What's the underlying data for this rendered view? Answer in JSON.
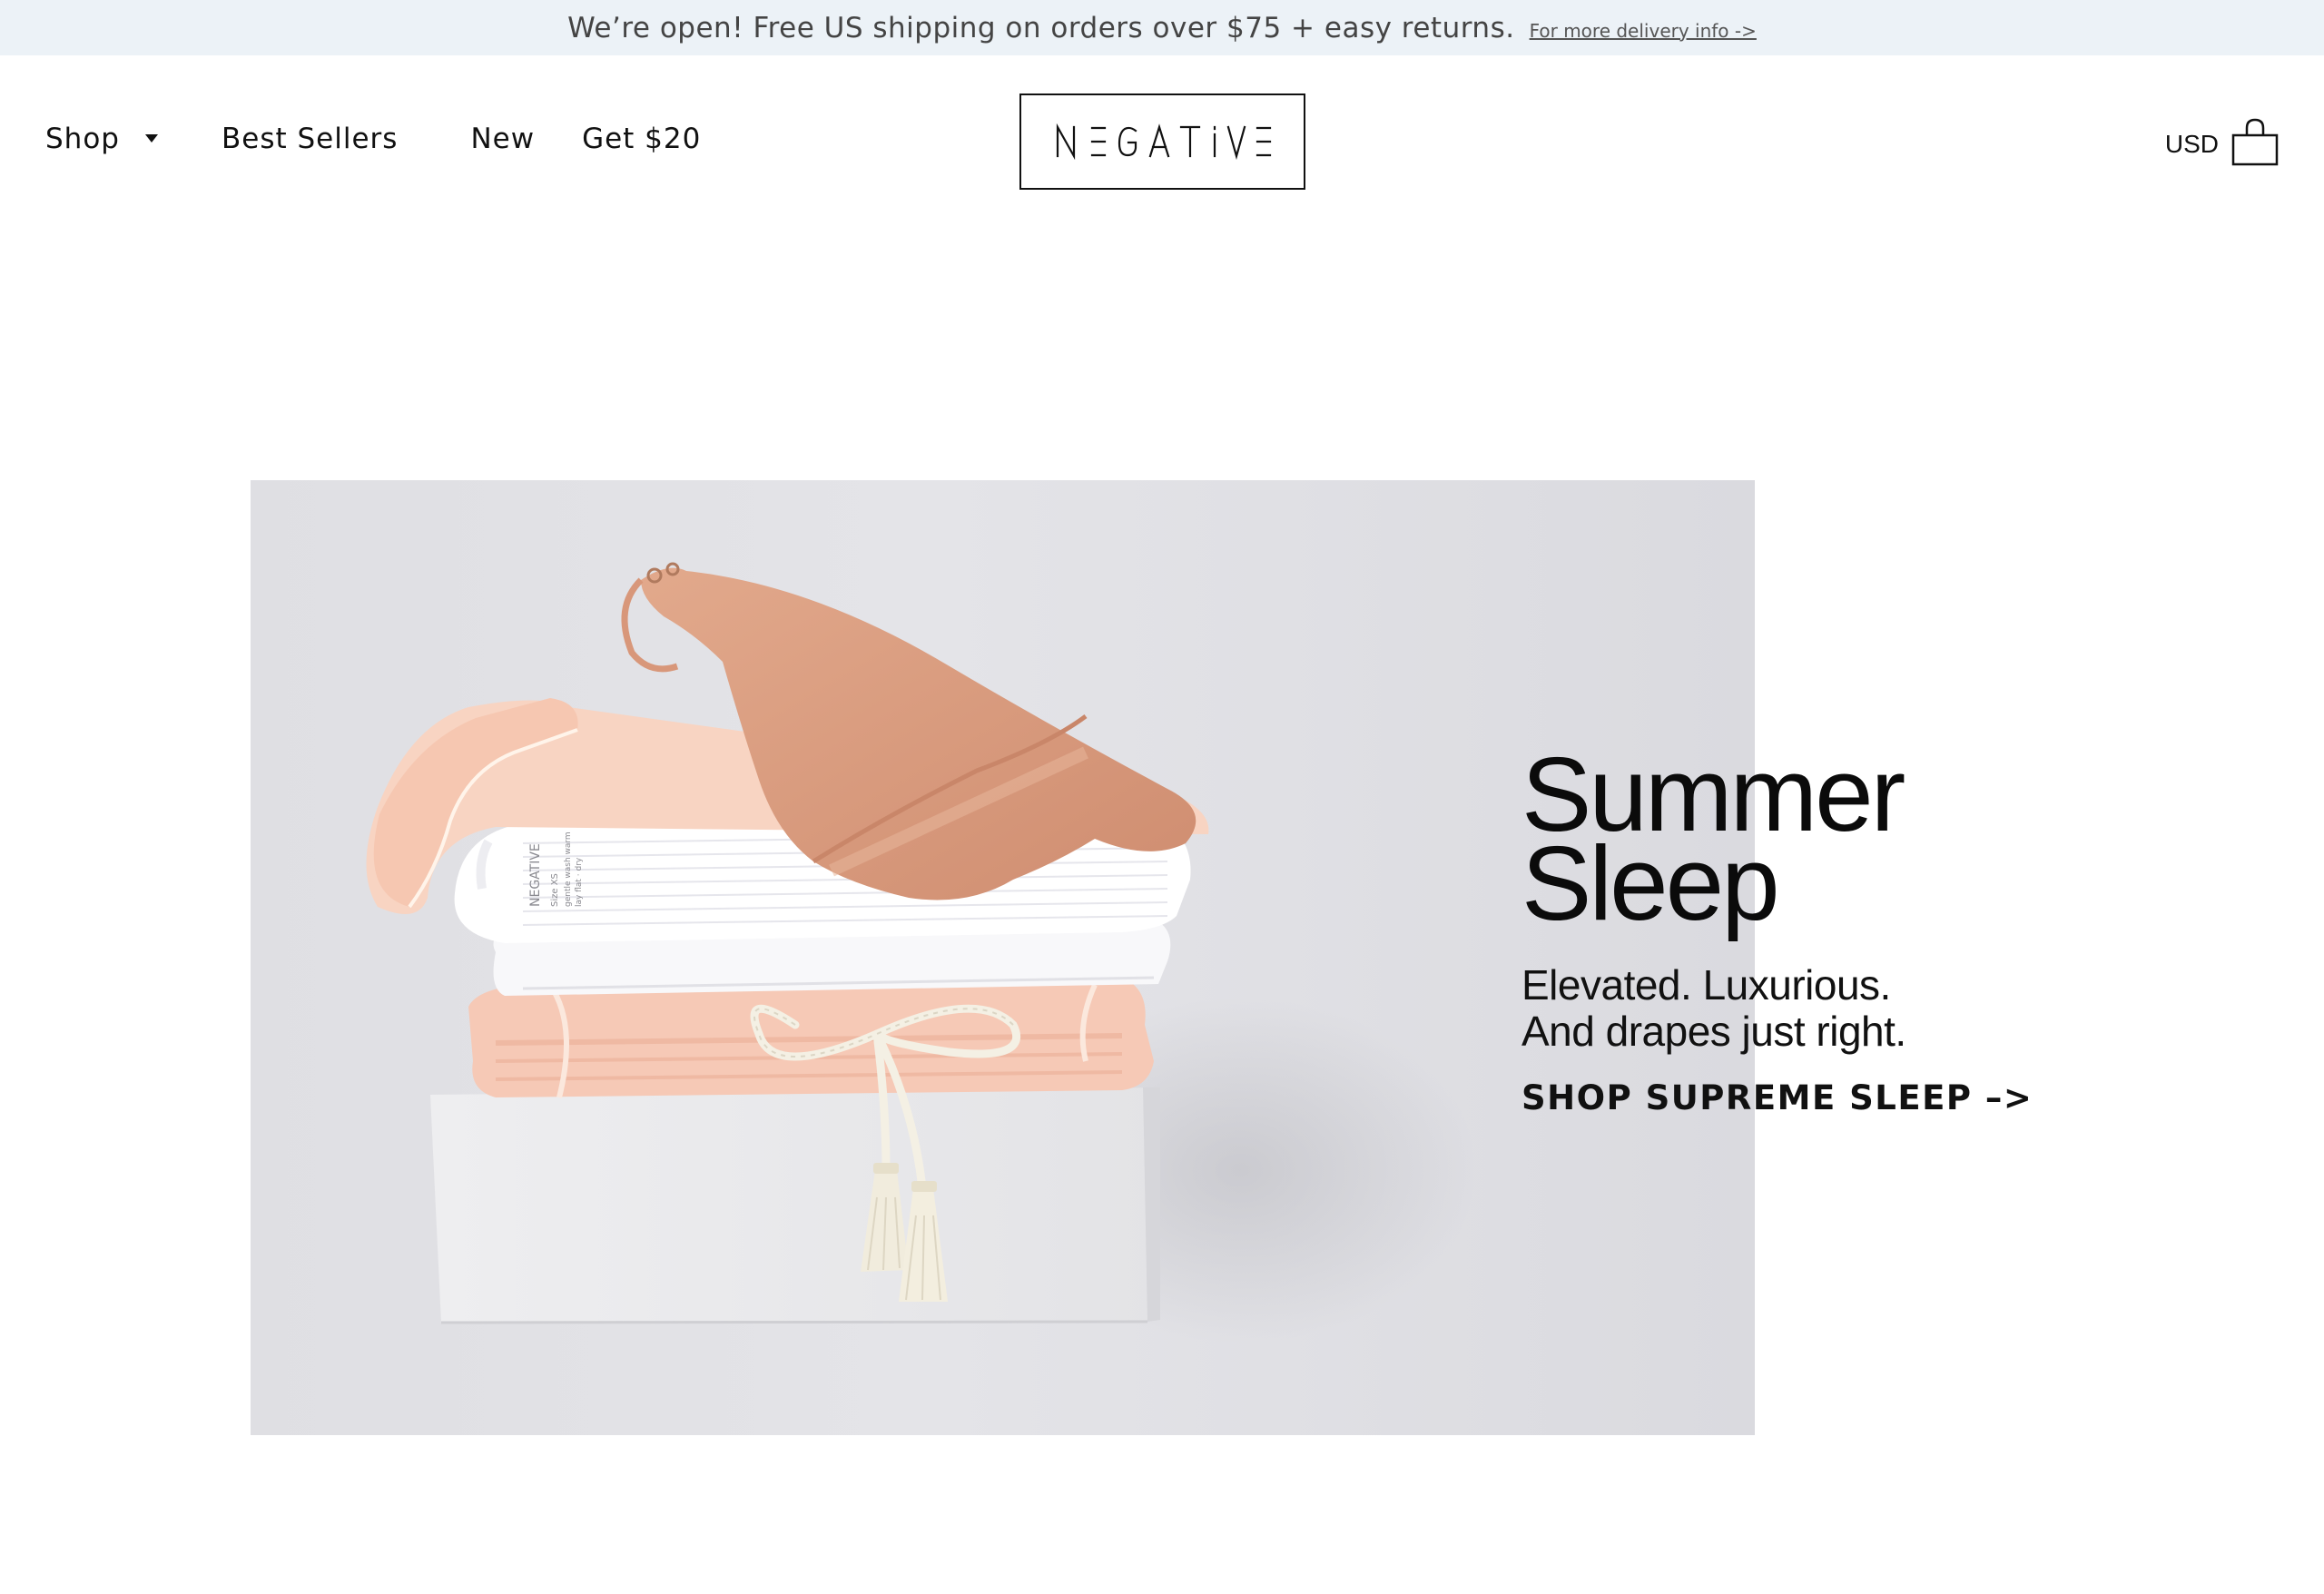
{
  "announcement": {
    "text": "We’re open! Free US shipping on orders over $75 + easy returns.",
    "link": "For more delivery info ->"
  },
  "nav": {
    "items": [
      {
        "label": "Shop",
        "has_dropdown": true
      },
      {
        "label": "Best Sellers"
      },
      {
        "label": "New"
      },
      {
        "label": "Get $20"
      }
    ]
  },
  "brand": {
    "logo_text": "NEGATIVE"
  },
  "header_right": {
    "currency": "USD",
    "cart_icon": "shopping-bag-icon"
  },
  "hero": {
    "title_lines": [
      "Summer",
      "Sleep"
    ],
    "subtitle_lines": [
      "Elevated. Luxurious.",
      "And drapes just right."
    ],
    "cta": "SHOP SUPREME SLEEP –>",
    "image": "folded-sleepwear-stack-on-white-box"
  },
  "colors": {
    "announcement_bg": "#ecf2f7",
    "text": "#111111",
    "hero_bg": "#e2e2e6",
    "blush": "#f6cdb9",
    "tan": "#d9977a"
  }
}
